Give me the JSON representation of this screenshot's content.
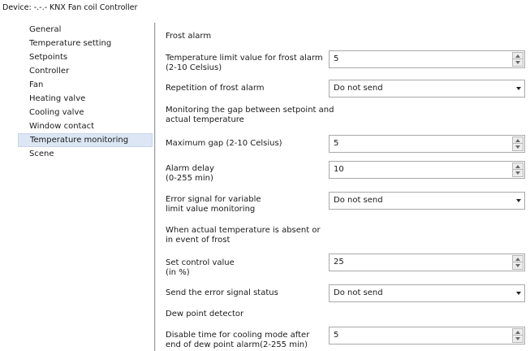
{
  "window": {
    "title": "Device: -.-.-  KNX Fan coil Controller"
  },
  "sidebar": {
    "items": [
      {
        "label": "General"
      },
      {
        "label": "Temperature setting"
      },
      {
        "label": "Setpoints"
      },
      {
        "label": "Controller"
      },
      {
        "label": "Fan"
      },
      {
        "label": "Heating valve"
      },
      {
        "label": "Cooling valve"
      },
      {
        "label": "Window contact"
      },
      {
        "label": "Temperature monitoring",
        "selected": true
      },
      {
        "label": "Scene"
      }
    ]
  },
  "params": {
    "frost_alarm_heading": "Frost alarm",
    "frost_temp_limit": {
      "line1": "Temperature limit value for frost alarm",
      "line2": "(2-10 Celsius)",
      "value": "5"
    },
    "frost_repetition": {
      "label": "Repetition of frost alarm",
      "value": "Do not send"
    },
    "gap_heading": {
      "line1": "Monitoring the gap between setpoint and",
      "line2": "actual temperature"
    },
    "maximum_gap": {
      "label": "Maximum gap  (2-10 Celsius)",
      "value": "5"
    },
    "alarm_delay": {
      "line1": "Alarm delay",
      "line2": "(0-255 min)",
      "value": "10"
    },
    "error_signal": {
      "line1": "Error signal for variable",
      "line2": "limit value monitoring",
      "value": "Do not send"
    },
    "absent_heading": {
      "line1": "When actual temperature is absent or",
      "line2": "in event of frost"
    },
    "set_control_value": {
      "line1": "Set control value",
      "line2": "(in %)",
      "value": "25"
    },
    "error_signal_status": {
      "label": "Send the error signal status",
      "value": "Do not send"
    },
    "dew_point_heading": "Dew point detector",
    "disable_time": {
      "line1": "Disable time for cooling mode after",
      "line2": "end of dew point alarm(2-255 min)",
      "value": "5"
    }
  }
}
